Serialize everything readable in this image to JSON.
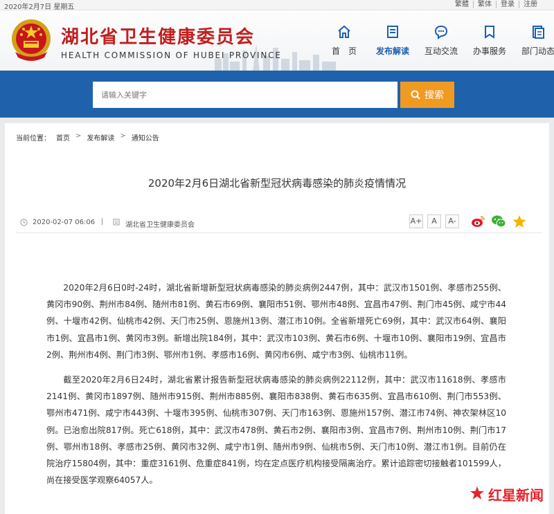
{
  "topbar": {
    "date": "2020年2月7日 星期五",
    "links": [
      "繁體",
      "繁体",
      "登录",
      "注册"
    ]
  },
  "header": {
    "org_name": "湖北省卫生健康委员会",
    "org_en": "HEALTH COMMISSION OF HUBEI PROVINCE",
    "nav": [
      {
        "label": "首　页",
        "icon": "home-icon",
        "active": false
      },
      {
        "label": "发布解读",
        "icon": "document-icon",
        "active": true
      },
      {
        "label": "互动交流",
        "icon": "chat-icon",
        "active": false
      },
      {
        "label": "办事服务",
        "icon": "bookmark-icon",
        "active": false
      },
      {
        "label": "部门动态",
        "icon": "news-icon",
        "active": false
      }
    ]
  },
  "search": {
    "placeholder": "请输入关键字",
    "button_label": "搜索"
  },
  "breadcrumb": {
    "prefix": "当前位置：",
    "items": [
      "首页",
      "发布解读",
      "通知公告"
    ]
  },
  "article": {
    "title": "2020年2月6日湖北省新型冠状病毒感染的肺炎疫情情况",
    "date": "2020-02-07 06:06",
    "separator": "|",
    "source": "湖北省卫生健康委员会",
    "font_buttons": [
      "A+",
      "A",
      "A-"
    ],
    "paragraphs": [
      "2020年2月6日0时-24时，湖北省新增新型冠状病毒感染的肺炎病例2447例，其中：武汉市1501例、孝感市255例、黄冈市90例、荆州市84例、随州市81例、黄石市69例、襄阳市51例、鄂州市48例、宜昌市47例、荆门市45例、咸宁市44例、十堰市42例、仙桃市42例、天门市25例、恩施州13例、潜江市10例。全省新增死亡69例，其中：武汉市64例、襄阳市1例、宜昌市1例、黄冈市3例。新增出院184例，其中：武汉市103例、黄石市6例、十堰市10例、襄阳市19例、宜昌市2例、荆州市4例、荆门市3例、鄂州市1例、孝感市16例、黄冈市6例、咸宁市3例、仙桃市11例。",
      "截至2020年2月6日24时，湖北省累计报告新型冠状病毒感染的肺炎病例22112例，其中：武汉市11618例、孝感市2141例、黄冈市1897例、随州市915例、荆州市885例、襄阳市838例、黄石市635例、宜昌市610例、荆门市553例、鄂州市471例、咸宁市443例、十堰市395例、仙桃市307例、天门市163例、恩施州157例、潜江市74例、神农架林区10例。已治愈出院817例。死亡618例，其中：武汉市478例、黄石市2例、襄阳市3例、宜昌市7例、荆州市10例、荆门市17例、鄂州市18例、孝感市25例、黄冈市32例、咸宁市1例、随州市9例、仙桃市5例、天门市10例、潜江市1例。目前仍在院治疗15804例，其中：重症3161例、危重症841例，均在定点医疗机构接受隔离治疗。累计追踪密切接触者101599人，尚在接受医学观察64057人。"
    ]
  },
  "watermark": {
    "text": "红星新闻"
  },
  "colors": {
    "brand_red": "#c21e1e",
    "search_band": "#1f62ab",
    "search_button": "#f19a22",
    "nav_active": "#1b5fb0"
  }
}
